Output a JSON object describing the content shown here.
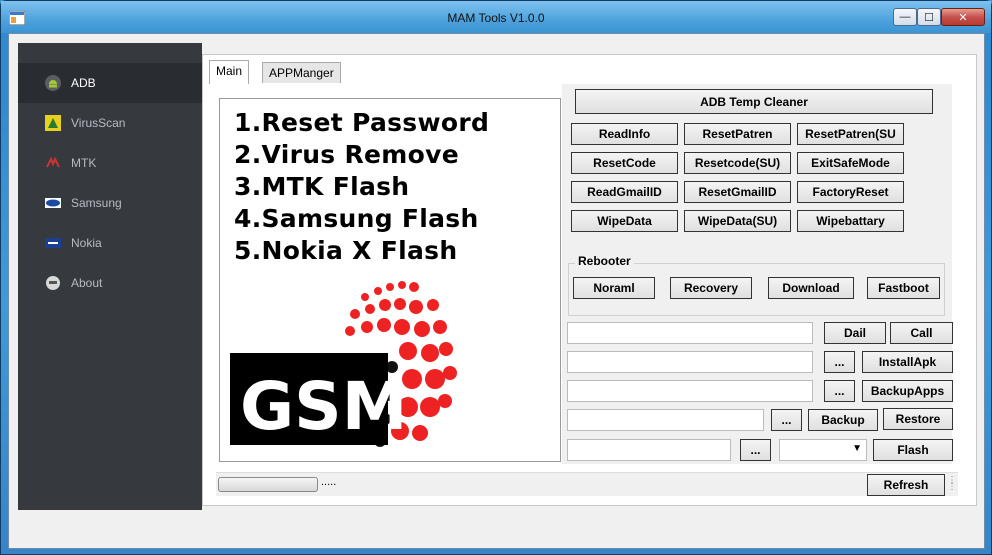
{
  "window": {
    "title": "MAM Tools V1.0.0",
    "minimize": "—",
    "maximize": "☐",
    "close": "✕"
  },
  "sidebar": {
    "items": [
      {
        "label": "ADB"
      },
      {
        "label": "VirusScan"
      },
      {
        "label": "MTK"
      },
      {
        "label": "Samsung"
      },
      {
        "label": "Nokia"
      },
      {
        "label": "About"
      }
    ]
  },
  "tabs": [
    {
      "label": "Main"
    },
    {
      "label": "APPManger"
    }
  ],
  "features": [
    "1.Reset Password",
    "2.Virus Remove",
    "3.MTK Flash",
    "4.Samsung Flash",
    "5.Nokia X Flash"
  ],
  "logo_text": "GSM",
  "adb": {
    "temp_cleaner": "ADB Temp Cleaner",
    "row1": [
      "ReadInfo",
      "ResetPatren",
      "ResetPatren(SU"
    ],
    "row2": [
      "ResetCode",
      "Resetcode(SU)",
      "ExitSafeMode"
    ],
    "row3": [
      "ReadGmailID",
      "ResetGmailID",
      "FactoryReset"
    ],
    "row4": [
      "WipeData",
      "WipeData(SU)",
      "Wipebattary"
    ]
  },
  "rebooter": {
    "label": "Rebooter",
    "buttons": [
      "Noraml",
      "Recovery",
      "Download",
      "Fastboot"
    ]
  },
  "actions": {
    "dial": "Dail",
    "call": "Call",
    "browse": "...",
    "install_apk": "InstallApk",
    "backup_apps": "BackupApps",
    "backup": "Backup",
    "restore": "Restore",
    "flash": "Flash",
    "refresh": "Refresh"
  },
  "status": {
    "text": "....."
  }
}
